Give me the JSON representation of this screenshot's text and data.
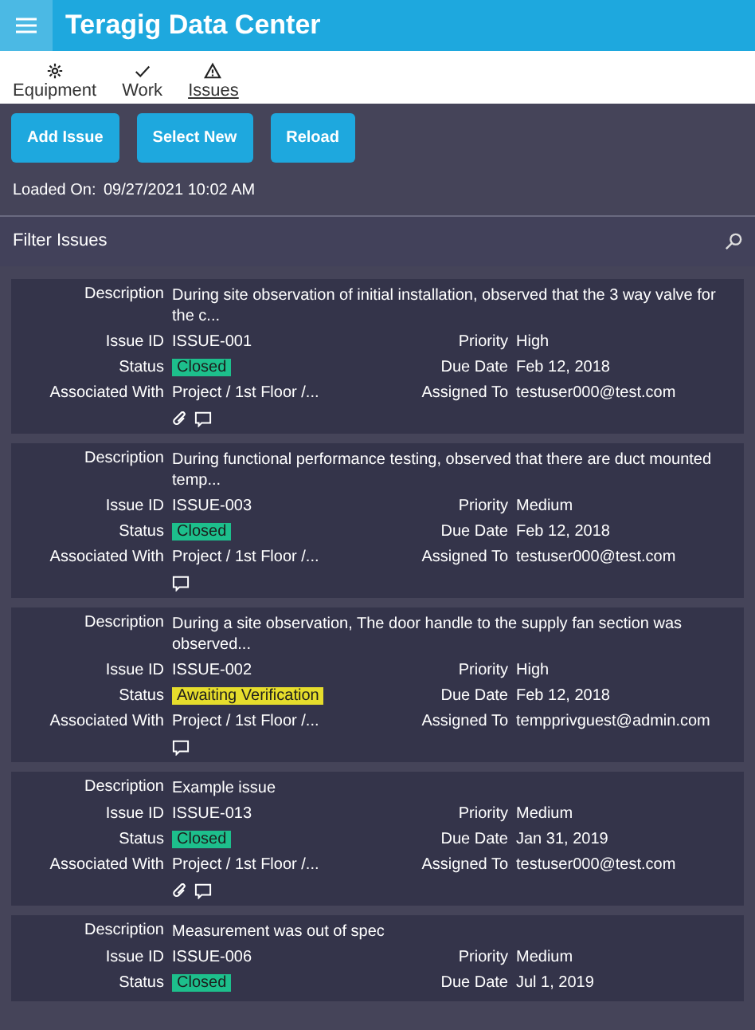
{
  "app_bar": {
    "title": "Teragig Data Center"
  },
  "tabs": [
    {
      "label": "Equipment",
      "selected": false
    },
    {
      "label": "Work",
      "selected": false
    },
    {
      "label": "Issues",
      "selected": true
    }
  ],
  "buttons": [
    "Add Issue",
    "Select New",
    "Reload"
  ],
  "loaded": {
    "label": "Loaded On:",
    "value": "09/27/2021 10:02 AM"
  },
  "filter": {
    "placeholder": "Filter Issues"
  },
  "issues": [
    {
      "description": {
        "label": "Description",
        "value": "During site observation of initial installation, observed that the 3 way valve for the c..."
      },
      "pairs": [
        [
          {
            "label": "Issue ID",
            "value": "ISSUE-001"
          },
          {
            "label": "Priority",
            "value": "High"
          }
        ],
        [
          {
            "label": "Status",
            "value": "Closed",
            "kind": "status",
            "color": "#1dbf8c"
          },
          {
            "label": "Due Date",
            "value": "Feb 12, 2018"
          }
        ],
        [
          {
            "label": "Associated With",
            "value": "Project / 1st Floor /..."
          },
          {
            "label": "Assigned To",
            "value": "testuser000@test.com"
          }
        ]
      ],
      "attachment": true,
      "comment": true
    },
    {
      "description": {
        "label": "Description",
        "value": "During functional performance testing, observed that there are duct mounted temp..."
      },
      "pairs": [
        [
          {
            "label": "Issue ID",
            "value": "ISSUE-003"
          },
          {
            "label": "Priority",
            "value": "Medium"
          }
        ],
        [
          {
            "label": "Status",
            "value": "Closed",
            "kind": "status",
            "color": "#1dbf8c"
          },
          {
            "label": "Due Date",
            "value": "Feb 12, 2018"
          }
        ],
        [
          {
            "label": "Associated With",
            "value": "Project / 1st Floor /..."
          },
          {
            "label": "Assigned To",
            "value": "testuser000@test.com"
          }
        ]
      ],
      "attachment": false,
      "comment": true
    },
    {
      "description": {
        "label": "Description",
        "value": "During a site observation, The door handle to the supply fan section was observed..."
      },
      "pairs": [
        [
          {
            "label": "Issue ID",
            "value": "ISSUE-002"
          },
          {
            "label": "Priority",
            "value": "High"
          }
        ],
        [
          {
            "label": "Status",
            "value": "Awaiting Verification",
            "kind": "status",
            "color": "#e6dd2c"
          },
          {
            "label": "Due Date",
            "value": "Feb 12, 2018"
          }
        ],
        [
          {
            "label": "Associated With",
            "value": "Project / 1st Floor /..."
          },
          {
            "label": "Assigned To",
            "value": "tempprivguest@admin.com"
          }
        ]
      ],
      "attachment": false,
      "comment": true
    },
    {
      "description": {
        "label": "Description",
        "value": "Example issue"
      },
      "pairs": [
        [
          {
            "label": "Issue ID",
            "value": "ISSUE-013"
          },
          {
            "label": "Priority",
            "value": "Medium"
          }
        ],
        [
          {
            "label": "Status",
            "value": "Closed",
            "kind": "status",
            "color": "#1dbf8c"
          },
          {
            "label": "Due Date",
            "value": "Jan 31, 2019"
          }
        ],
        [
          {
            "label": "Associated With",
            "value": "Project / 1st Floor /..."
          },
          {
            "label": "Assigned To",
            "value": "testuser000@test.com"
          }
        ]
      ],
      "attachment": true,
      "comment": true
    },
    {
      "description": {
        "label": "Description",
        "value": "Measurement  was out of spec"
      },
      "pairs": [
        [
          {
            "label": "Issue ID",
            "value": "ISSUE-006"
          },
          {
            "label": "Priority",
            "value": "Medium"
          }
        ],
        [
          {
            "label": "Status",
            "value": "Closed",
            "kind": "status",
            "color": "#1dbf8c"
          },
          {
            "label": "Due Date",
            "value": "Jul 1, 2019"
          }
        ]
      ]
    }
  ]
}
